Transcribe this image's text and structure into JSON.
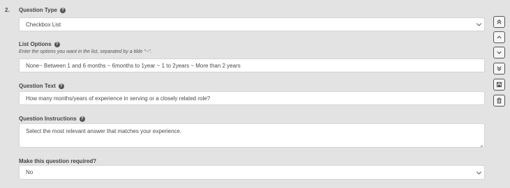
{
  "question": {
    "number": "2.",
    "type_label": "Question Type",
    "type_value": "Checkbox List",
    "options_label": "List Options",
    "options_hint": "Enter the options you want in the list, separated by a tilde \"~\".",
    "options_value": "None~ Between 1 and 6 months ~ 6months to 1year ~ 1 to 2years ~ More than 2 years",
    "text_label": "Question Text",
    "text_value": "How many months/years of experience in serving or a closely related role?",
    "instructions_label": "Question Instructions",
    "instructions_value": "Select the most relevant answer that matches your experience.",
    "required_label": "Make this question required?",
    "required_value": "No"
  },
  "help_glyph": "?",
  "side_actions": [
    {
      "icon": "double-chevron-up-icon"
    },
    {
      "icon": "chevron-up-icon"
    },
    {
      "icon": "chevron-down-icon"
    },
    {
      "icon": "double-chevron-down-icon"
    },
    {
      "icon": "save-icon"
    },
    {
      "icon": "trash-icon"
    }
  ]
}
